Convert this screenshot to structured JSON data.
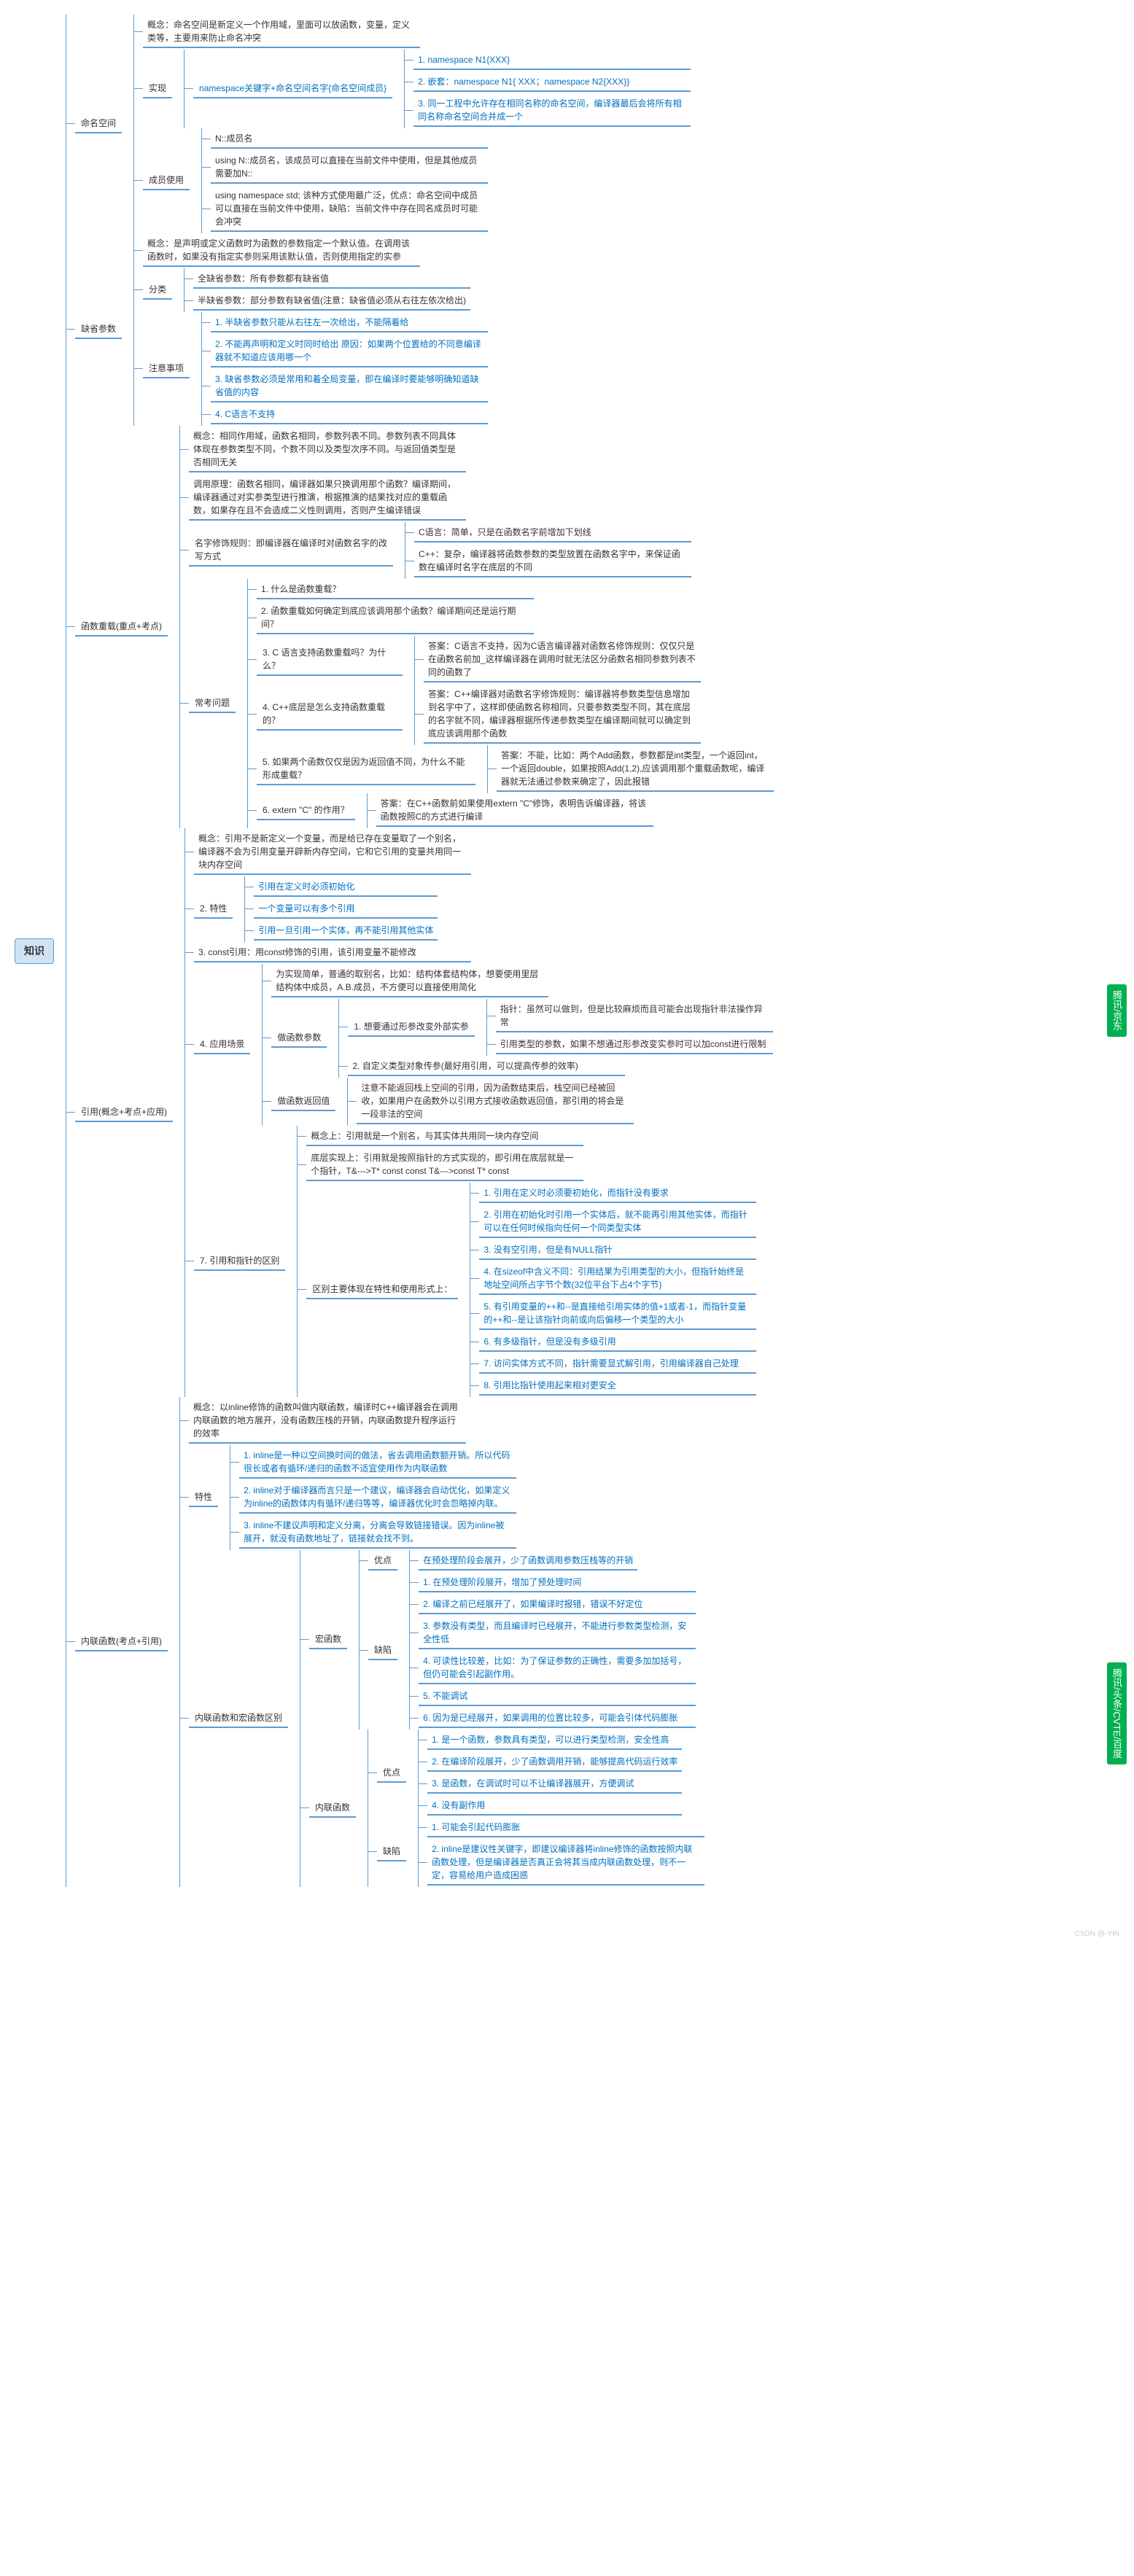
{
  "root": "知识",
  "tags": {
    "ref": "腾讯/京东",
    "inline": "腾讯/头条/CVTE/百度"
  },
  "ns": {
    "title": "命名空间",
    "concept": "概念：命名空间是新定义一个作用域，里面可以放函数，变量，定义类等，主要用来防止命名冲突",
    "impl": "实现",
    "impl_v": "namespace关键字+命名空间名字{命名空间成员}",
    "impl1": "1. namespace N1{XXX}",
    "impl2": "2. 嵌套：namespace N1{ XXX；namespace N2{XXX}}",
    "impl3": "3. 同一工程中允许存在相同名称的命名空间，编译器最后会将所有相同名称命名空间合并成一个",
    "mem": "成员使用",
    "mem1": "N::成员名",
    "mem2": "using N::成员名，该成员可以直接在当前文件中使用，但是其他成员需要加N::",
    "mem3": "using namespace std; 该种方式使用最广泛，优点：命名空间中成员可以直接在当前文件中使用，缺陷：当前文件中存在同名成员时可能会冲突"
  },
  "def": {
    "title": "缺省参数",
    "concept": "概念：是声明或定义函数时为函数的参数指定一个默认值。在调用该函数时，如果没有指定实参则采用该默认值，否则使用指定的实参",
    "cat": "分类",
    "cat1": "全缺省参数：所有参数都有缺省值",
    "cat2": "半缺省参数：部分参数有缺省值(注意：缺省值必须从右往左依次给出)",
    "note": "注意事项",
    "n1": "1. 半缺省参数只能从右往左一次给出，不能隔着给",
    "n2": "2. 不能再声明和定义时同时给出 原因：如果两个位置给的不同意编译器就不知道应该用哪一个",
    "n3": "3. 缺省参数必须是常用和着全局变量，即在编译时要能够明确知道缺省值的内容",
    "n4": "4. C语言不支持"
  },
  "ol": {
    "title": "函数重载(重点+考点)",
    "concept": "概念：相同作用域，函数名相同，参数列表不同。参数列表不同具体体现在参数类型不同，个数不同以及类型次序不同。与返回值类型是否相同无关",
    "call": "调用原理：函数名相同，编译器如果只换调用那个函数？编译期间，编译器通过对实参类型进行推演，根据推演的结果找对应的重载函数，如果存在且不会造成二义性则调用，否则产生编译错误",
    "mangle": "名字修饰规则：即编译器在编译时对函数名字的改写方式",
    "mangle_c": "C语言：简单，只是在函数名字前增加下划线",
    "mangle_cpp": "C++：复杂，编译器将函数参数的类型放置在函数名字中，来保证函数在编译时名字在底层的不同",
    "faq": "常考问题",
    "q1": "1. 什么是函数重载？",
    "q2": "2. 函数重载如何确定到底应该调用那个函数？编译期间还是运行期间？",
    "q3": "3. C 语言支持函数重载吗？为什么？",
    "q3a": "答案：C语言不支持，因为C语言编译器对函数名修饰规则：仅仅只是在函数名前加_这样编译器在调用时就无法区分函数名相同参数列表不同的函数了",
    "q4": "4. C++底层是怎么支持函数重载的？",
    "q4a": "答案：C++编译器对函数名字修饰规则：编译器将参数类型信息增加到名字中了，这样即使函数名称相同，只要参数类型不同，其在底层的名字就不同，编译器根据所传递参数类型在编译期间就可以确定到底应该调用那个函数",
    "q5": "5. 如果两个函数仅仅是因为返回值不同，为什么不能形成重载？",
    "q5a": "答案：不能，比如：两个Add函数，参数都是int类型，一个返回int，一个返回double，如果按照Add(1,2),应该调用那个重载函数呢，编译器就无法通过参数来确定了，因此报错",
    "q6": "6. extern \"C\" 的作用？",
    "q6a": "答案：在C++函数前如果使用extern \"C\"修饰，表明告诉编译器，将该函数按照C的方式进行编译"
  },
  "ref": {
    "title": "引用(概念+考点+应用)",
    "c": "概念：引用不是新定义一个变量，而是给已存在变量取了一个别名，编译器不会为引用变量开辟新内存空间，它和它引用的变量共用同一块内存空间",
    "feat": "2. 特性",
    "f1": "引用在定义时必须初始化",
    "f2": "一个变量可以有多个引用",
    "f3": "引用一旦引用一个实体，再不能引用其他实体",
    "c3": "3. const引用：用const修饰的引用，该引用变量不能修改",
    "use": "4. 应用场景",
    "use0": "为实现简单，普通的取别名，比如：结构体套结构体，想要使用里层结构体中成员，A.B.成员，不方便可以直接使用简化",
    "fp": "做函数参数",
    "fp1": "1. 想要通过形参改变外部实参",
    "fp1a": "指针：虽然可以做到，但是比较麻烦而且可能会出现指针非法操作异常",
    "fp1b": "引用类型的参数，如果不想通过形参改变实参时可以加const进行限制",
    "fp2": "2. 自定义类型对象传参(最好用引用，可以提高传参的效率)",
    "fr": "做函数返回值",
    "fr1": "注意不能返回栈上空间的引用，因为函数结束后，栈空间已经被回收，如果用户在函数外以引用方式接收函数返回值，那引用的将会是一段非法的空间",
    "d": "7. 引用和指针的区别",
    "d0": "概念上：引用就是一个别名，与其实体共用同一块内存空间",
    "d1": "底层实现上：引用就是按照指针的方式实现的，即引用在底层就是一个指针，T&--->T* const   const T&--->const T* const",
    "dd": "区别主要体现在特性和使用形式上：",
    "r1": "1. 引用在定义时必须要初始化，而指针没有要求",
    "r2": "2. 引用在初始化时引用一个实体后，就不能再引用其他实体，而指针可以在任何时候指向任何一个同类型实体",
    "r3": "3. 没有空引用，但是有NULL指针",
    "r4": "4. 在sizeof中含义不同：引用结果为引用类型的大小，但指针始终是地址空间所占字节个数(32位平台下占4个字节)",
    "r5": "5. 有引用变量的++和--是直接给引用实体的值+1或者-1，而指针变量的++和--是让该指针向前或向后偏移一个类型的大小",
    "r6": "6. 有多级指针，但是没有多级引用",
    "r7": "7. 访问实体方式不同，指针需要显式解引用，引用编译器自己处理",
    "r8": "8. 引用比指针使用起来相对更安全"
  },
  "il": {
    "title": "内联函数(考点+引用)",
    "c": "概念：以inline修饰的函数叫做内联函数，编译时C++编译器会在调用内联函数的地方展开，没有函数压栈的开销，内联函数提升程序运行的效率",
    "feat": "特性",
    "f1": "1. inline是一种以空间换时间的做法，省去调用函数额开销。所以代码很长或者有循环/递归的函数不适宜使用作为内联函数",
    "f2": "2. inline对于编译器而言只是一个建议，编译器会自动优化，如果定义为inline的函数体内有循环/递归等等，编译器优化时会忽略掉内联。",
    "f3": "3. inline不建议声明和定义分离，分离会导致链接错误。因为inline被展开，就没有函数地址了，链接就会找不到。",
    "diff": "内联函数和宏函数区别",
    "macro": "宏函数",
    "mp": "优点",
    "mp1": "在预处理阶段会展开，少了函数调用参数压栈等的开销",
    "md": "缺陷",
    "md1": "1. 在预处理阶段展开，增加了预处理时间",
    "md2": "2. 编译之前已经展开了，如果编译时报错，错误不好定位",
    "md3": "3. 参数没有类型，而且编译时已经展开，不能进行参数类型检测，安全性低",
    "md4": "4. 可读性比较差，比如：为了保证参数的正确性，需要多加加括号，但仍可能会引起副作用。",
    "md5": "5. 不能调试",
    "md6": "6. 因为是已经展开，如果调用的位置比较多，可能会引体代码膨胀",
    "ifn": "内联函数",
    "ip": "优点",
    "ip1": "1. 是一个函数，参数具有类型，可以进行类型检测，安全性高",
    "ip2": "2. 在编译阶段展开，少了函数调用开销，能够提高代码运行效率",
    "ip3": "3. 是函数，在调试时可以不让编译器展开，方便调试",
    "ip4": "4. 没有副作用",
    "id": "缺陷",
    "id1": "1. 可能会引起代码膨胀",
    "id2": "2. inline是建议性关键字，即建议编译器将inline修饰的函数按照内联函数处理，但是编译器是否真正会将其当成内联函数处理，则不一定，容易给用户造成困惑"
  },
  "wm": "CSDN @-YIN"
}
